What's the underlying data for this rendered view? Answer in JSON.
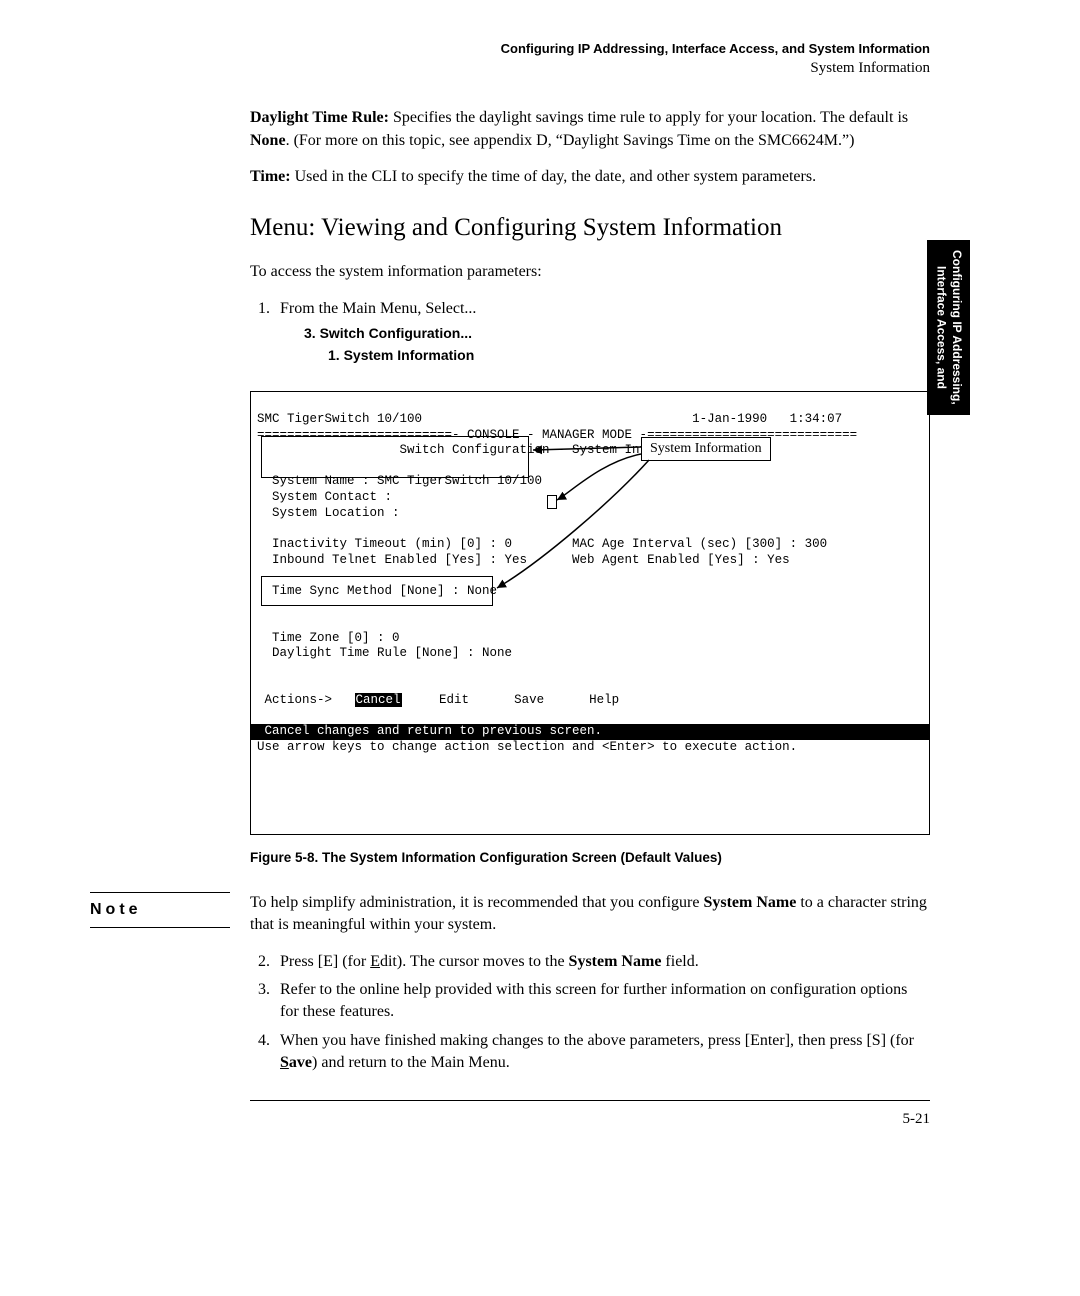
{
  "header": {
    "title": "Configuring IP Addressing, Interface Access, and System Information",
    "subtitle": "System Information"
  },
  "side_tab": {
    "line1": "Configuring IP Addressing,",
    "line2": "Interface Access, and"
  },
  "para_dtr": {
    "lead": "Daylight Time Rule:",
    "body": " Specifies the daylight savings time rule to apply for your location. The default is ",
    "bold2": "None",
    "tail": ". (For more on this topic, see appendix D, “Daylight Savings Time on the SMC6624M.”)"
  },
  "para_time": {
    "lead": "Time:",
    "body": " Used in the CLI to specify the time of day, the date, and other system parameters."
  },
  "section_heading": "Menu: Viewing and Configuring System Information",
  "intro_line": "To access the system information parameters:",
  "step1": "From the Main Menu, Select...",
  "switch_conf": "3. Switch Configuration...",
  "sys_info": "1. System Information",
  "console": {
    "l1": "SMC TigerSwitch 10/100                                    1-Jan-1990   1:34:07",
    "l2": "==========================- CONSOLE - MANAGER MODE -============================",
    "l3": "                   Switch Configuration - System Information",
    "blank1": " ",
    "l4": "  System Name : SMC TigerSwitch 10/100",
    "l5": "  System Contact :",
    "l6": "  System Location :",
    "blank2": " ",
    "l7": "  Inactivity Timeout (min) [0] : 0        MAC Age Interval (sec) [300] : 300",
    "l8": "  Inbound Telnet Enabled [Yes] : Yes      Web Agent Enabled [Yes] : Yes",
    "blank3": " ",
    "l9": "  Time Sync Method [None] : None",
    "blank4": " ",
    "blank4b": " ",
    "l10": "  Time Zone [0] : 0",
    "l11": "  Daylight Time Rule [None] : None",
    "blank5": " ",
    "blank6": " ",
    "actions_prefix": " Actions->   ",
    "cancel": "Cancel",
    "actions_suffix": "     Edit      Save      Help",
    "blank7": " ",
    "bar": " Cancel changes and return to previous screen.                                  ",
    "hint": "Use arrow keys to change action selection and <Enter> to execute action."
  },
  "callout_label": "System Information",
  "figure_caption": "Figure 5-8.  The System Information Configuration Screen (Default Values)",
  "note_label": "Note",
  "note_body": {
    "pre": "To help simplify administration, it is recommended that you configure ",
    "bold": "System Name",
    "post": "  to a character string that is meaningful within your system."
  },
  "step2": {
    "pre": "Press [E] (for ",
    "u": "E",
    "mid": "dit). The cursor moves to the ",
    "bold": "System Name",
    "post": " field."
  },
  "step3": "Refer to the online help provided with this screen for further information on configuration options for these features.",
  "step4": {
    "pre": "When you have finished making changes to the above parameters, press [Enter], then press [S] (for ",
    "u": "S",
    "bold_rest": "ave",
    "post": ") and return to the Main Menu."
  },
  "page_number": "5-21"
}
